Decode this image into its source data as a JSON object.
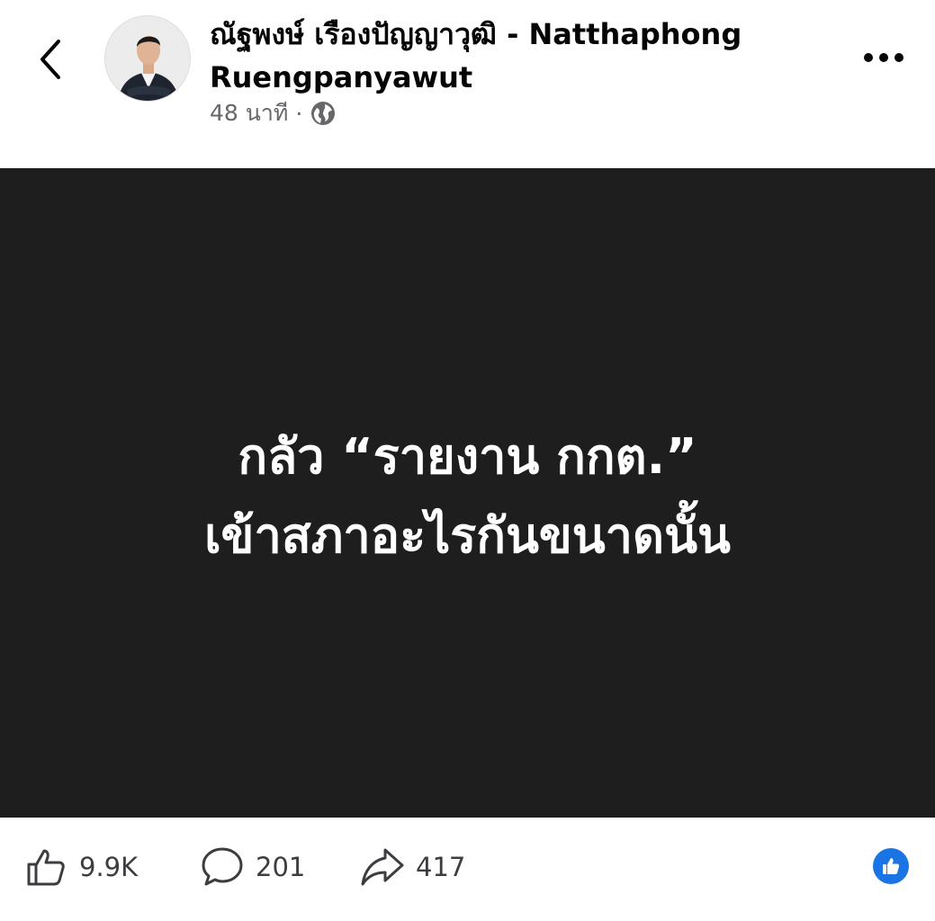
{
  "header": {
    "author_name": "ณัฐพงษ์ เรืองปัญญาวุฒิ - Natthaphong Ruengpanyawut",
    "time_ago": "48 นาที",
    "separator": "·",
    "privacy_icon": "globe-icon",
    "back_icon": "chevron-left-icon",
    "more_icon": "more-horizontal-icon"
  },
  "post": {
    "background_color": "#1e1e1e",
    "text_color": "#ffffff",
    "lines": [
      "กลัว “รายงาน กกต.”",
      "เข้าสภาอะไรกันขนาดนั้น"
    ]
  },
  "actions": {
    "like_count": "9.9K",
    "comment_count": "201",
    "share_count": "417",
    "reaction_icon": "like-reaction-icon",
    "reaction_color": "#1b74e4"
  }
}
